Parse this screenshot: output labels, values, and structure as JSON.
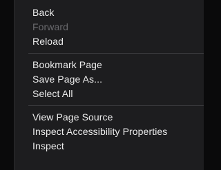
{
  "context_menu": {
    "groups": [
      {
        "items": [
          {
            "label": "Back",
            "enabled": true
          },
          {
            "label": "Forward",
            "enabled": false
          },
          {
            "label": "Reload",
            "enabled": true
          }
        ]
      },
      {
        "items": [
          {
            "label": "Bookmark Page",
            "enabled": true
          },
          {
            "label": "Save Page As...",
            "enabled": true
          },
          {
            "label": "Select All",
            "enabled": true
          }
        ]
      },
      {
        "items": [
          {
            "label": "View Page Source",
            "enabled": true
          },
          {
            "label": "Inspect Accessibility Properties",
            "enabled": true
          },
          {
            "label": "Inspect",
            "enabled": true
          }
        ]
      }
    ]
  }
}
